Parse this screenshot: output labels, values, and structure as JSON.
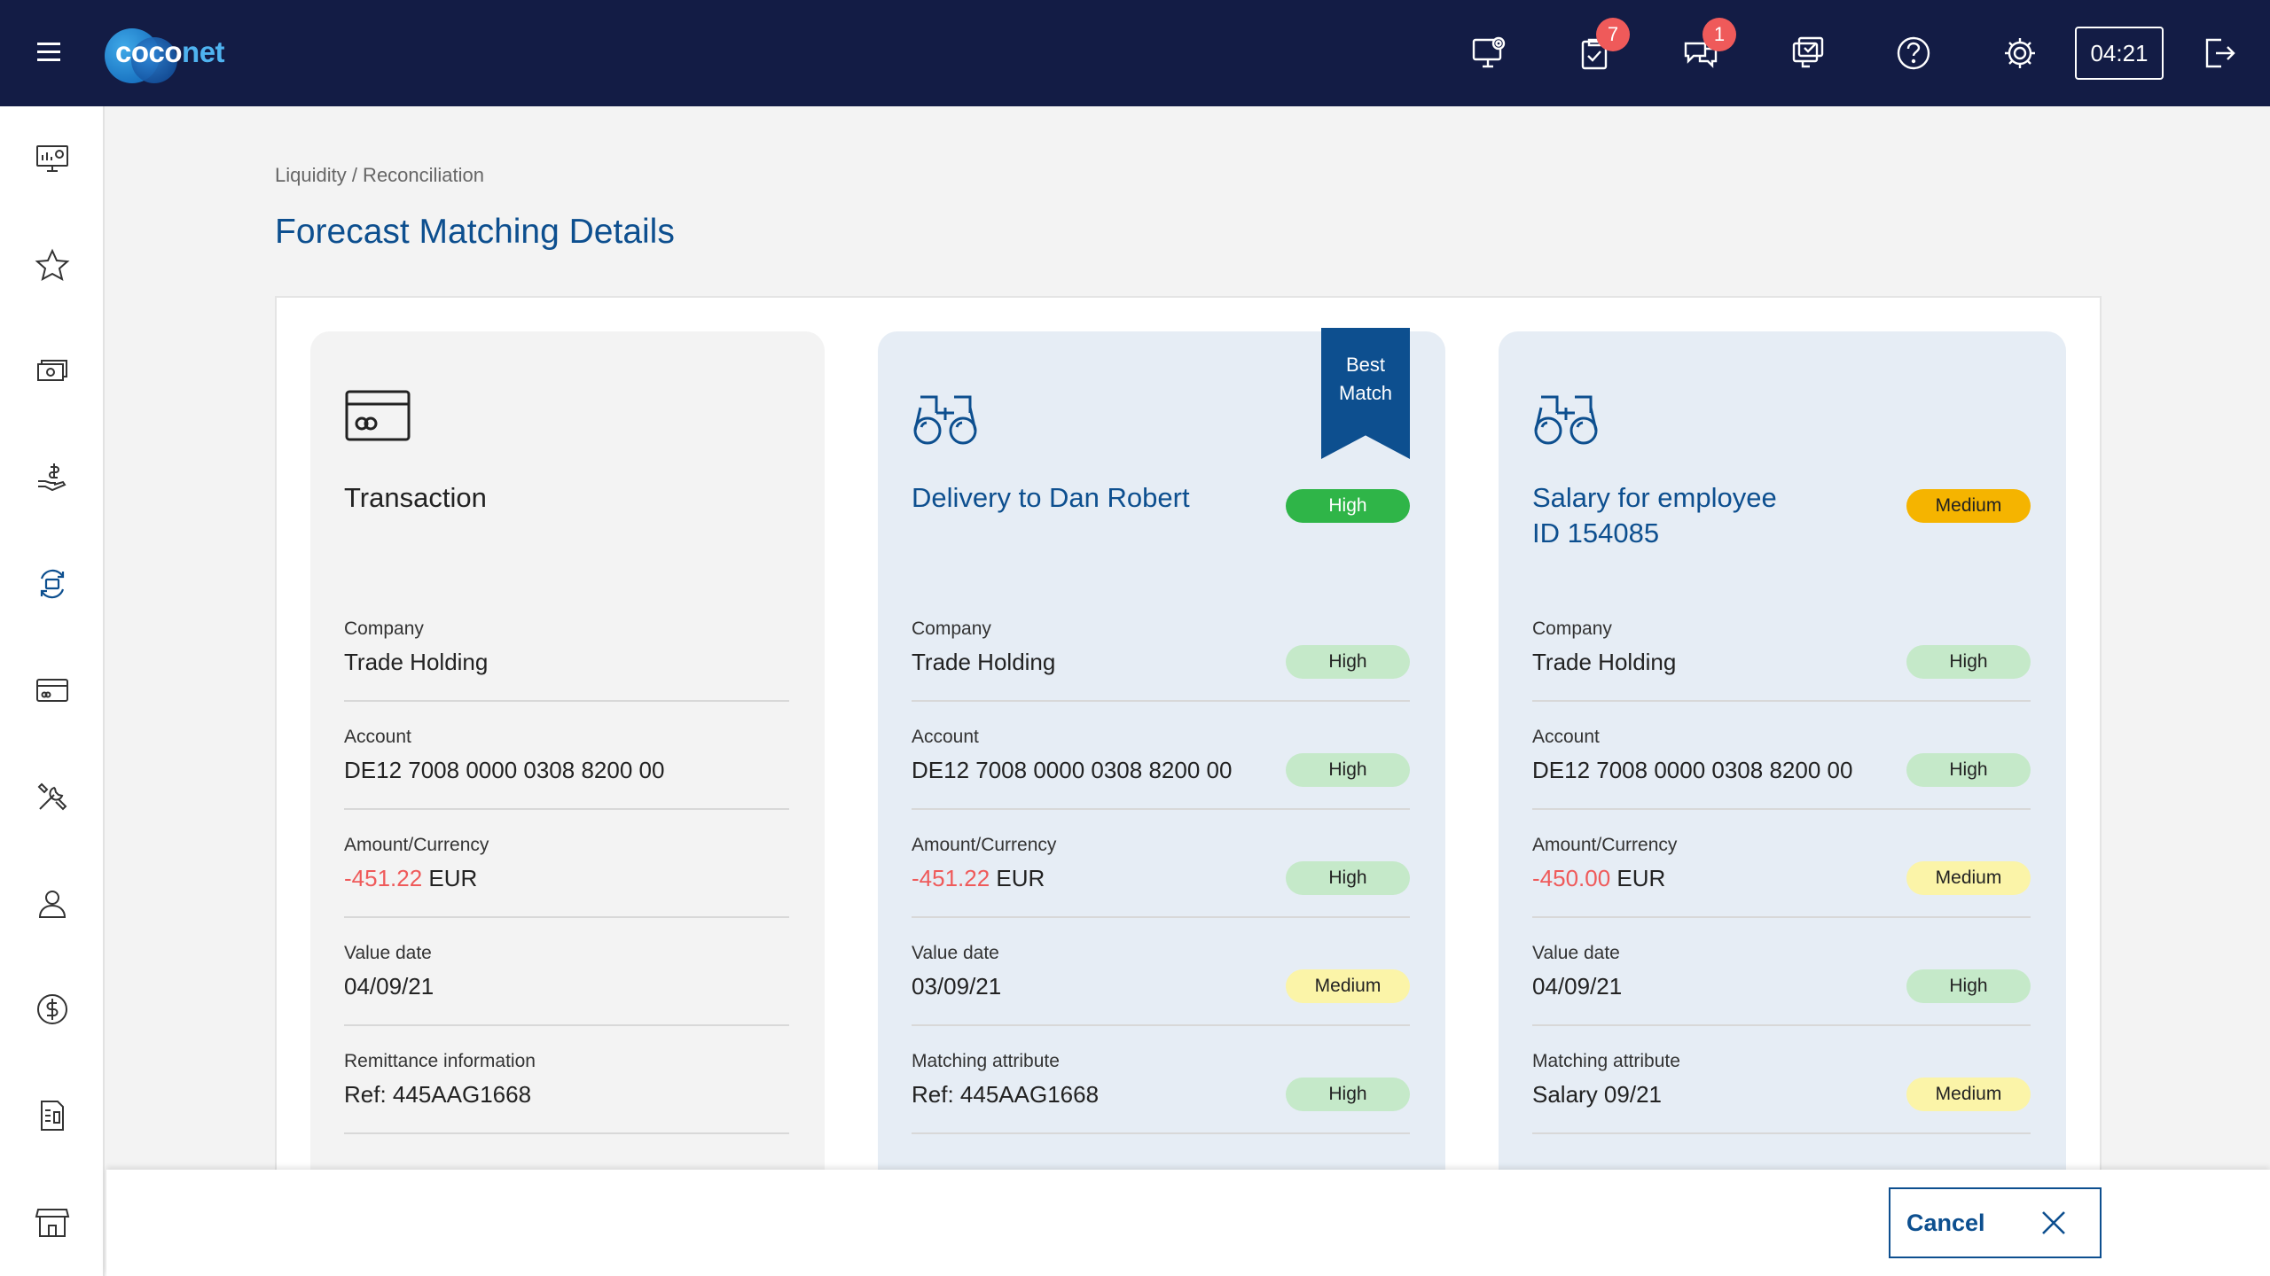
{
  "app": {
    "logo_text_a": "coco",
    "logo_text_b": "net"
  },
  "topbar": {
    "icons": [
      "monitor-settings-icon",
      "tasks-icon",
      "chat-icon",
      "monitor-check-icon",
      "help-icon",
      "gear-icon",
      "logout-icon"
    ],
    "tasks_badge": "7",
    "chat_badge": "1",
    "session_time": "04:21"
  },
  "sidebar": {
    "icons": [
      "dashboard-icon",
      "star-icon",
      "cash-icon",
      "hand-money-icon",
      "reconcile-icon",
      "card-icon",
      "tools-icon",
      "user-icon",
      "dollar-icon",
      "document-icon",
      "store-icon"
    ],
    "active": "reconcile-icon"
  },
  "breadcrumb": "Liquidity / Reconciliation",
  "page_title": "Forecast Matching Details",
  "colors": {
    "primary": "#0d4f8f",
    "topbar": "#131c45",
    "negative": "#ef5a5a",
    "high_strong": "#2fb548",
    "medium_strong": "#f5b400"
  },
  "transaction": {
    "title": "Transaction",
    "fields": [
      {
        "label": "Company",
        "value": "Trade Holding"
      },
      {
        "label": "Account",
        "value": "DE12 7008 0000 0308 8200 00"
      },
      {
        "label": "Amount/Currency",
        "amount": "-451.22",
        "currency": " EUR"
      },
      {
        "label": "Value date",
        "value": "04/09/21"
      },
      {
        "label": "Remittance information",
        "value": "Ref: 445AAG1668"
      }
    ]
  },
  "matches": [
    {
      "title": "Delivery to Dan Robert",
      "rating": "High",
      "ribbon": [
        "Best",
        "Match"
      ],
      "fields": [
        {
          "label": "Company",
          "value": "Trade Holding",
          "rating": "High"
        },
        {
          "label": "Account",
          "value": "DE12 7008 0000 0308 8200 00",
          "rating": "High"
        },
        {
          "label": "Amount/Currency",
          "amount": "-451.22",
          "currency": " EUR",
          "rating": "High"
        },
        {
          "label": "Value date",
          "value": "03/09/21",
          "rating": "Medium"
        },
        {
          "label": "Matching attribute",
          "value": "Ref: 445AAG1668",
          "rating": "High"
        }
      ]
    },
    {
      "title_line1": "Salary for employee",
      "title_line2": "ID 154085",
      "rating": "Medium",
      "fields": [
        {
          "label": "Company",
          "value": "Trade Holding",
          "rating": "High"
        },
        {
          "label": "Account",
          "value": "DE12 7008 0000 0308 8200 00",
          "rating": "High"
        },
        {
          "label": "Amount/Currency",
          "amount": "-450.00",
          "currency": " EUR",
          "rating": "Medium"
        },
        {
          "label": "Value date",
          "value": "04/09/21",
          "rating": "High"
        },
        {
          "label": "Matching attribute",
          "value": "Salary 09/21",
          "rating": "Medium"
        }
      ]
    }
  ],
  "footer": {
    "cancel_label": "Cancel"
  }
}
